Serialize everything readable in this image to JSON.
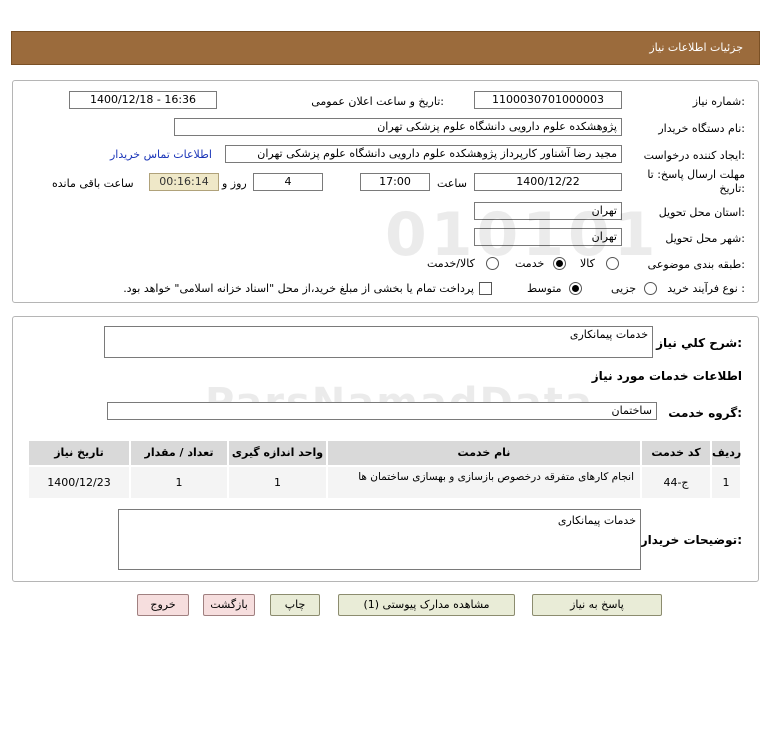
{
  "header": {
    "title": "جزئیات اطلاعات نیاز"
  },
  "form": {
    "need_number_label": "شماره نیاز:",
    "need_number": "1100030701000003",
    "announce_label": "تاریخ و ساعت اعلان عمومی:",
    "announce_value": "1400/12/18 - 16:36",
    "buyer_org_label": "نام دستگاه خریدار:",
    "buyer_org": "پژوهشکده علوم دارویی دانشگاه علوم پزشکی تهران",
    "creator_label": "ایجاد کننده درخواست:",
    "creator": "مجید رضا آشناور کارپرداز پژوهشکده علوم دارویی دانشگاه علوم پزشکی تهران",
    "contact_link": "اطلاعات تماس خریدار",
    "deadline_label_1": "مهلت ارسال پاسخ: تا",
    "deadline_label_2": "تاریخ:",
    "deadline_date": "1400/12/22",
    "time_label": "ساعت",
    "deadline_time": "17:00",
    "days_value": "4",
    "days_label": "روز و",
    "remaining_time": "00:16:14",
    "remaining_label": "ساعت باقی مانده",
    "province_label": "استان محل تحویل:",
    "province": "تهران",
    "city_label": "شهر محل تحویل:",
    "city": "تهران",
    "category_label": "طبقه بندی موضوعی:",
    "category_options": [
      "کالا",
      "خدمت",
      "کالا/خدمت"
    ],
    "category_selected": "خدمت",
    "process_label": "نوع فرآیند خرید :",
    "process_options": [
      "جزیی",
      "متوسط"
    ],
    "process_selected": "متوسط",
    "payment_note": "پرداخت تمام یا بخشی از مبلغ خرید،از محل \"اسناد خزانه اسلامی\" خواهد بود."
  },
  "details": {
    "summary_label": "شرح کلي نياز:",
    "summary": "خدمات پیمانکاری",
    "service_info_title": "اطلاعات خدمات مورد نیاز",
    "service_group_label": "گروه خدمت:",
    "service_group": "ساختمان",
    "table": {
      "headers": [
        "ردیف",
        "کد خدمت",
        "نام خدمت",
        "واحد اندازه گیری",
        "تعداد / مقدار",
        "تاریخ نیاز"
      ],
      "rows": [
        [
          "1",
          "ج-44",
          "انجام کارهای متفرقه درخصوص بازسازی و بهسازی ساختمان ها",
          "1",
          "1",
          "1400/12/23"
        ]
      ]
    },
    "buyer_notes_label": "توضیحات خریدار:",
    "buyer_notes": "خدمات پیمانکاری"
  },
  "buttons": {
    "reply": "پاسخ به نیاز",
    "attachments": "مشاهده مدارک پیوستی (1)",
    "print": "چاپ",
    "back": "بازگشت",
    "exit": "خروج"
  },
  "colors": {
    "header_bg": "#9b6b3c",
    "link": "#1a35b8",
    "timer_bg": "#efe8c8",
    "button_bg": "#e9ecd7",
    "button_pink_bg": "#f6dede"
  }
}
